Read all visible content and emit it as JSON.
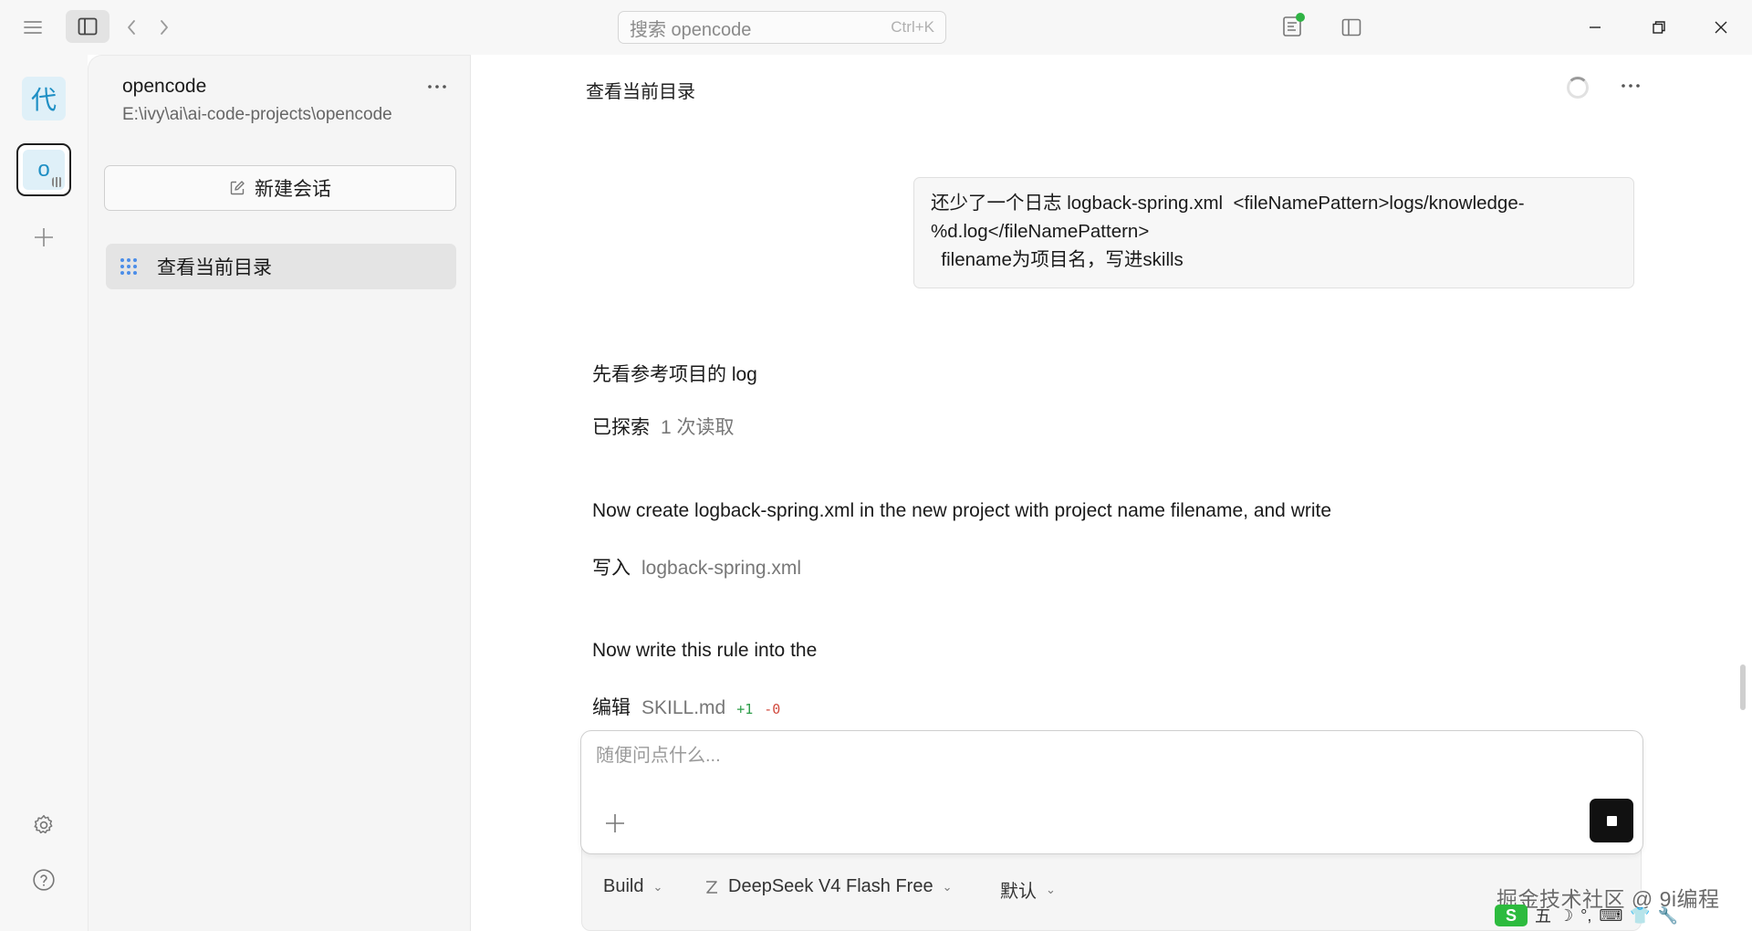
{
  "titlebar": {
    "search_placeholder": "搜索 opencode",
    "search_shortcut": "Ctrl+K"
  },
  "rail": {
    "projects": [
      {
        "initial": "代",
        "active": false
      },
      {
        "initial": "o",
        "active": true
      }
    ]
  },
  "sidebar": {
    "project_name": "opencode",
    "project_path": "E:\\ivy\\ai\\ai-code-projects\\opencode",
    "new_session_label": "新建会话",
    "sessions": [
      {
        "title": "查看当前目录",
        "active": true
      }
    ]
  },
  "chat": {
    "title": "查看当前目录",
    "user_message": {
      "line1": "还少了一个日志 logback-spring.xml  <fileNamePattern>logs/knowledge-%d.log</fileNamePattern>",
      "line2": "  filename为项目名，写进skills"
    },
    "assistant": {
      "text1": "先看参考项目的 log",
      "tool1_verb": "已探索",
      "tool1_target": "1 次读取",
      "text2": "Now create logback-spring.xml in the new project with project name filename, and write",
      "tool2_verb": "写入",
      "tool2_target": "logback-spring.xml",
      "text3": "Now write this rule into the",
      "tool3_verb": "编辑",
      "tool3_target": "SKILL.md",
      "tool3_additions": "+1",
      "tool3_deletions": "-0"
    }
  },
  "composer": {
    "placeholder": "随便问点什么...",
    "agent": "Build",
    "model": "DeepSeek V4 Flash Free",
    "variant": "默认"
  },
  "overlay": {
    "watermark": "掘金技术社区 @ 9i编程",
    "ime_logo": "S",
    "ime_mode": "五",
    "ime_moon": "☽",
    "ime_punct": "°,",
    "ime_keyboard": "⌨",
    "ime_skin": "👕",
    "ime_tool": "🔧"
  },
  "colors": {
    "accent_blue": "#1e8fc4",
    "status_green": "#2fb344",
    "diff_add": "#2e9e4a",
    "diff_del": "#d14b3f"
  }
}
